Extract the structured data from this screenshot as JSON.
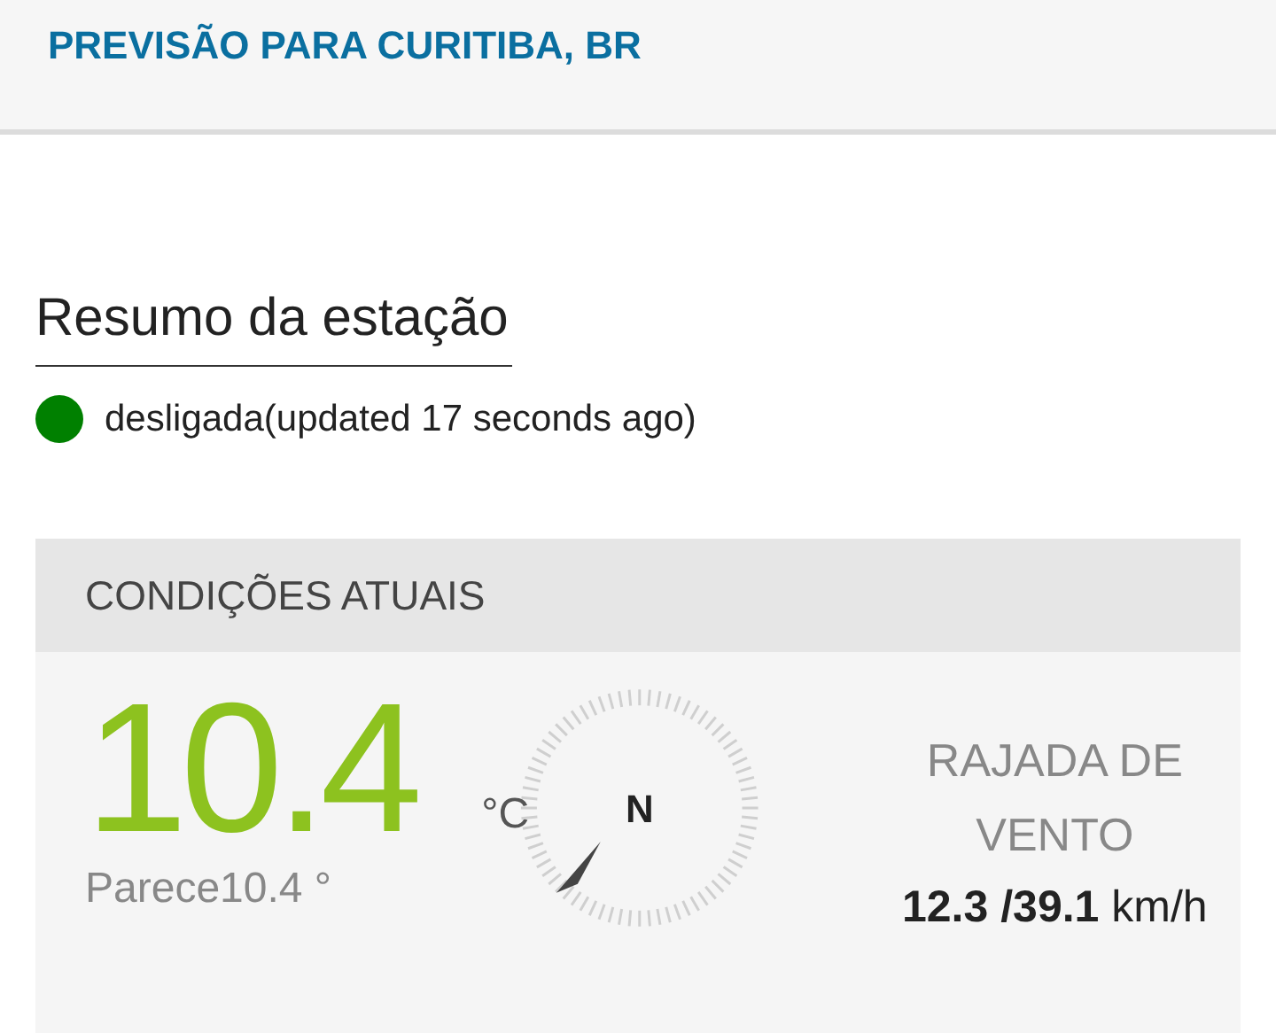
{
  "header": {
    "title": "PREVISÃO PARA CURITIBA, BR"
  },
  "station": {
    "heading": "Resumo da estação",
    "status": {
      "color": "#008000",
      "text": "desligada(updated 17 seconds ago)"
    }
  },
  "conditions": {
    "title": "CONDIÇÕES ATUAIS",
    "temperature": "10.4",
    "unit": "°C",
    "feels_like": "Parece10.4 °",
    "compass_label": "N",
    "gust_label": "RAJADA DE VENTO",
    "gust_value": "**12.3 /39.1** km/h"
  }
}
